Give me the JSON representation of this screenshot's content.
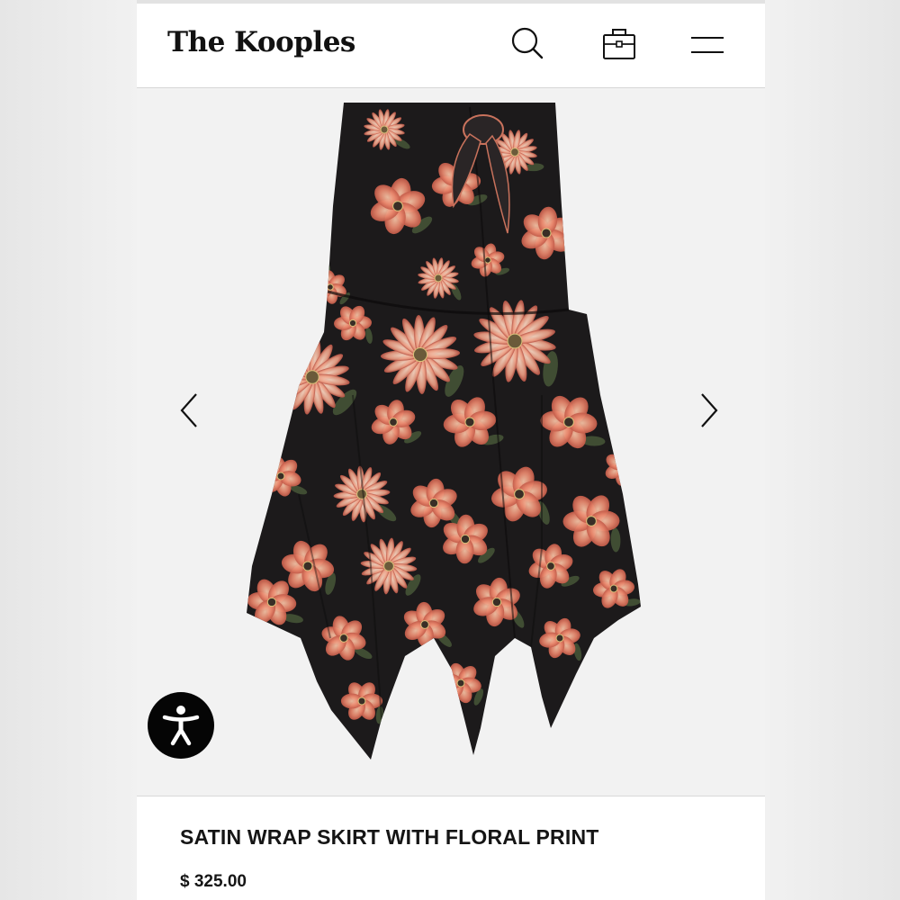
{
  "header": {
    "brand": "The Kooples",
    "icons": [
      "search-icon",
      "shopping-bag-icon",
      "hamburger-menu-icon"
    ]
  },
  "gallery": {
    "image_subject": "floral-satin-wrap-skirt",
    "prev_icon": "chevron-left-icon",
    "next_icon": "chevron-right-icon"
  },
  "accessibility": {
    "icon": "accessibility-person-icon"
  },
  "product": {
    "title": "SATIN WRAP SKIRT WITH FLORAL PRINT",
    "price": "$ 325.00"
  },
  "colors": {
    "fabric": "#1c1a1b",
    "petal_coral": "#e48a70",
    "petal_peach": "#f0a88a",
    "petal_dark": "#c25a48",
    "background": "#f2f2f2"
  }
}
